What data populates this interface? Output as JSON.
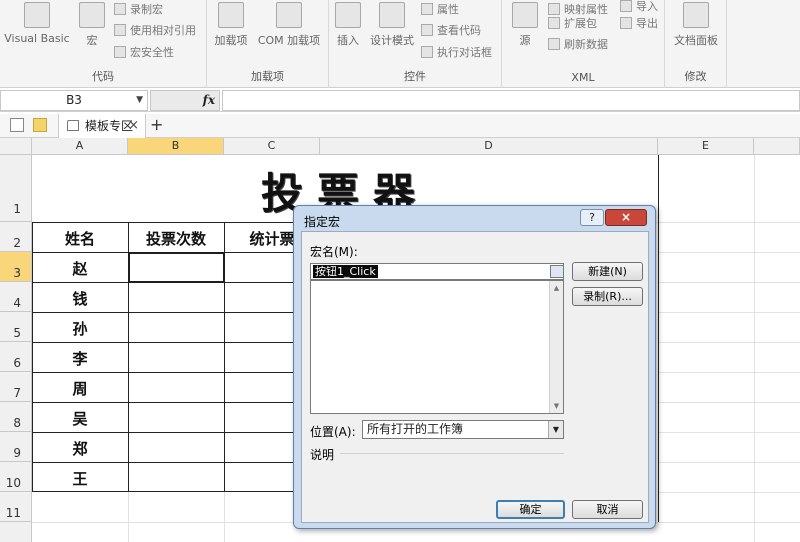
{
  "ribbon": {
    "groups": [
      {
        "label": "代码",
        "big": [
          "Visual Basic",
          "宏"
        ],
        "small": [
          "录制宏",
          "使用相对引用",
          "宏安全性"
        ]
      },
      {
        "label": "加载项",
        "big": [
          "加载项",
          "COM 加载项"
        ]
      },
      {
        "label": "控件",
        "big": [
          "插入",
          "设计模式"
        ],
        "small": [
          "属性",
          "查看代码",
          "执行对话框"
        ]
      },
      {
        "label": "XML",
        "big": [
          "源"
        ],
        "small": [
          "映射属性",
          "扩展包",
          "刷新数据",
          "导入",
          "导出"
        ]
      },
      {
        "label": "修改",
        "big": [
          "文档面板"
        ]
      }
    ]
  },
  "formula_bar": {
    "name_box": "B3",
    "fx": "fx",
    "value": ""
  },
  "tabs": {
    "items": [
      {
        "label": "模板专区"
      }
    ],
    "add": "+",
    "close": "×"
  },
  "grid": {
    "columns": [
      "A",
      "B",
      "C",
      "D",
      "E"
    ],
    "rows": [
      "1",
      "2",
      "3",
      "4",
      "5",
      "6",
      "7",
      "8",
      "9",
      "10",
      "11"
    ],
    "title": "投票器",
    "headers": [
      "姓名",
      "投票次数",
      "统计票"
    ],
    "names": [
      "赵",
      "钱",
      "孙",
      "李",
      "周",
      "吴",
      "郑",
      "王"
    ]
  },
  "dialog": {
    "title": "指定宏",
    "help": "?",
    "close": "×",
    "macro_name_label": "宏名(M):",
    "macro_name_value": "按钮1_Click",
    "new_button": "新建(N)",
    "record_button": "录制(R)...",
    "location_label": "位置(A):",
    "location_value": "所有打开的工作簿",
    "description_label": "说明",
    "ok_button": "确定",
    "cancel_button": "取消"
  }
}
